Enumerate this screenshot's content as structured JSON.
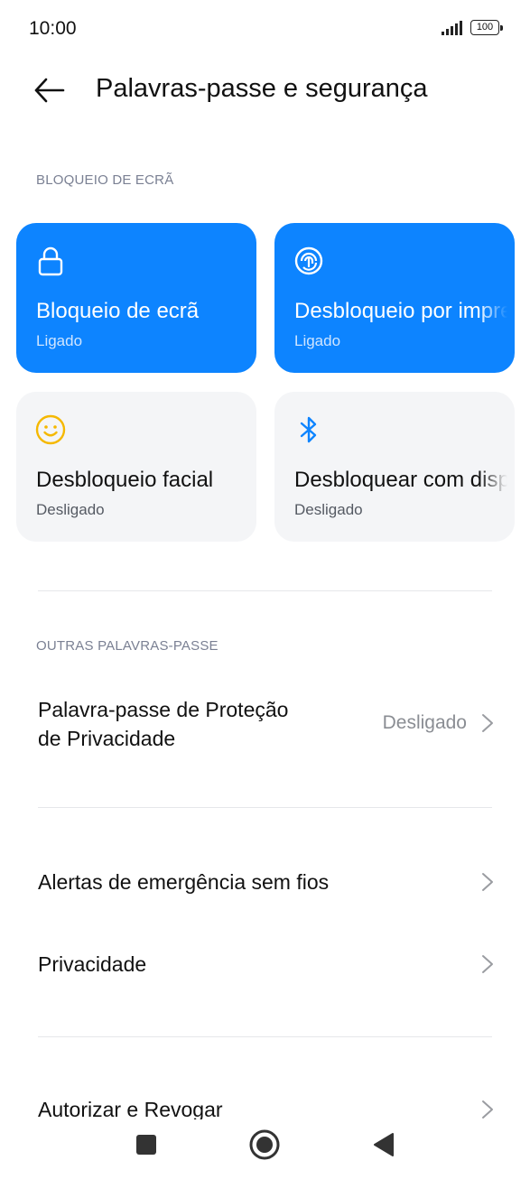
{
  "status_bar": {
    "time": "10:00",
    "battery": "100",
    "icons": [
      "signal-icon",
      "battery-icon"
    ]
  },
  "header": {
    "back_icon": "back-arrow-icon",
    "title": "Palavras-passe e segurança"
  },
  "screen_lock_section": {
    "label": "BLOQUEIO DE ECRÃ",
    "tiles": [
      {
        "title": "Bloqueio de ecrã",
        "status": "Ligado",
        "icon": "lock-icon",
        "active": true
      },
      {
        "title": "Desbloqueio por impressão digital",
        "status": "Ligado",
        "icon": "fingerprint-icon",
        "active": true
      },
      {
        "title": "Desbloqueio facial",
        "status": "Desligado",
        "icon": "face-icon",
        "active": false
      },
      {
        "title": "Desbloquear com dispositivo Bluetooth",
        "status": "Desligado",
        "icon": "bluetooth-icon",
        "active": false
      }
    ]
  },
  "other_passwords_section": {
    "label": "OUTRAS PALAVRAS-PASSE",
    "items": [
      {
        "title_line1": "Palavra-passe de Proteção",
        "title_line2": "de Privacidade",
        "value": "Desligado"
      }
    ]
  },
  "more_items": [
    {
      "title": "Alertas de emergência sem fios"
    },
    {
      "title": "Privacidade"
    },
    {
      "title": "Autorizar e Revogar"
    }
  ],
  "nav_bar": {
    "buttons": [
      "recents-square-icon",
      "home-circle-icon",
      "back-triangle-icon"
    ]
  },
  "colors": {
    "accent": "#0d84ff",
    "tile_off_bg": "#f4f5f7",
    "section_label": "#7a8093",
    "face_icon": "#f5b800"
  }
}
